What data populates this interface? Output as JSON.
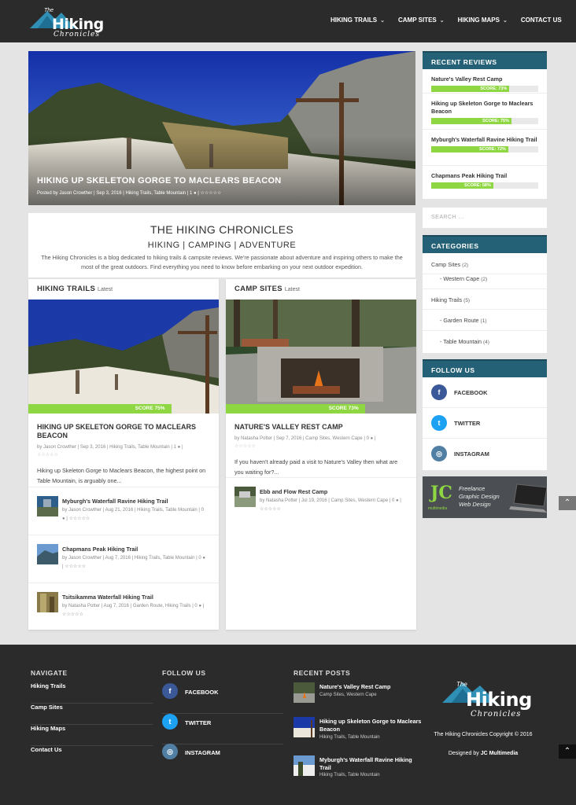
{
  "site": {
    "logo_the": "The",
    "logo_main": "Hiking",
    "logo_sub": "Chronicles"
  },
  "nav": [
    {
      "label": "HIKING TRAILS",
      "dropdown": true
    },
    {
      "label": "CAMP SITES",
      "dropdown": true
    },
    {
      "label": "HIKING MAPS",
      "dropdown": true
    },
    {
      "label": "CONTACT US",
      "dropdown": false
    }
  ],
  "hero": {
    "title": "HIKING UP SKELETON GORGE TO MACLEARS BEACON",
    "meta": "Posted by Jason Crowther | Sep 3, 2016 | Hiking Trails, Table Mountain | 1 ● | ☆☆☆☆☆"
  },
  "intro": {
    "title": "THE HIKING CHRONICLES",
    "subtitle": "HIKING | CAMPING | ADVENTURE",
    "text": "The Hiking Chronicles is a blog dedicated to hiking trails & campsite reviews. We're passionate about adventure and inspiring others to make the most of the great outdoors. Find everything you need to know before embarking on your next outdoor expedition."
  },
  "hiking_trails": {
    "heading": "HIKING TRAILS",
    "latest": "Latest",
    "score": "SCORE 75%",
    "title": "HIKING UP SKELETON GORGE TO MACLEARS BEACON",
    "meta": "by Jason Crowther | Sep 3, 2016 | Hiking Trails, Table Mountain | 1 ● |",
    "stars": "☆☆☆☆☆",
    "excerpt": "Hiking up Skeleton Gorge to Maclears Beacon, the highest point on Table Mountain, is arguably one...",
    "items": [
      {
        "title": "Myburgh's Waterfall Ravine Hiking Trail",
        "meta": "by Jason Crowther | Aug 21, 2016 | Hiking Trails, Table Mountain | 0 ● | ☆☆☆☆☆"
      },
      {
        "title": "Chapmans Peak Hiking Trail",
        "meta": "by Jason Crowther | Aug 7, 2016 | Hiking Trails, Table Mountain | 0 ● | ☆☆☆☆☆"
      },
      {
        "title": "Tsitsikamma Waterfall Hiking Trail",
        "meta": "by Natasha Potter | Aug 7, 2016 | Garden Route, Hiking Trails | 0 ● | ☆☆☆☆☆"
      }
    ]
  },
  "camp_sites": {
    "heading": "CAMP SITES",
    "latest": "Latest",
    "score": "SCORE 73%",
    "title": "NATURE'S VALLEY REST CAMP",
    "meta": "by Natasha Potter | Sep 7, 2016 | Camp Sites, Western Cape | 0 ● |",
    "stars": "☆☆☆☆☆",
    "excerpt": "If you haven't already paid a visit to Nature's Valley then what are you waiting for?...",
    "items": [
      {
        "title": "Ebb and Flow Rest Camp",
        "meta": "by Natasha Potter | Jul 19, 2016 | Camp Sites, Western Cape | 0 ● | ☆☆☆☆☆"
      }
    ]
  },
  "recent_reviews": {
    "heading": "RECENT REVIEWS",
    "items": [
      {
        "title": "Nature's Valley Rest Camp",
        "score": "SCORE: 73%",
        "value": 0.73
      },
      {
        "title": "Hiking up Skeleton Gorge to Maclears Beacon",
        "score": "SCORE: 75%",
        "value": 0.75
      },
      {
        "title": "Myburgh's Waterfall Ravine Hiking Trail",
        "score": "SCORE: 72%",
        "value": 0.72
      },
      {
        "title": "Chapmans Peak Hiking Trail",
        "score": "SCORE: 58%",
        "value": 0.58
      }
    ]
  },
  "search": {
    "placeholder": "SEARCH ..."
  },
  "categories": {
    "heading": "CATEGORIES",
    "items": [
      {
        "label": "Camp Sites",
        "count": "(2)"
      },
      {
        "label": "- Western Cape",
        "count": "(2)"
      },
      {
        "label": "Hiking Trails",
        "count": "(5)"
      },
      {
        "label": "- Garden Route",
        "count": "(1)"
      },
      {
        "label": "- Table Mountain",
        "count": "(4)"
      }
    ]
  },
  "follow": {
    "heading": "FOLLOW US",
    "items": [
      {
        "label": "FACEBOOK",
        "icon": "facebook-icon",
        "color": "#3b5998"
      },
      {
        "label": "TWITTER",
        "icon": "twitter-icon",
        "color": "#1da1f2"
      },
      {
        "label": "INSTAGRAM",
        "icon": "instagram-icon",
        "color": "#517fa4"
      }
    ]
  },
  "ad": {
    "logo": "JC",
    "logo_sub": "multimedia",
    "lines": [
      "Freelance",
      "Graphic Design",
      "Web Design"
    ]
  },
  "footer": {
    "navigate_heading": "NAVIGATE",
    "navigate": [
      "Hiking Trails",
      "Camp Sites",
      "Hiking Maps",
      "Contact Us"
    ],
    "follow_heading": "FOLLOW US",
    "follow": [
      "FACEBOOK",
      "TWITTER",
      "INSTAGRAM"
    ],
    "recent_heading": "RECENT POSTS",
    "recent": [
      {
        "title": "Nature's Valley Rest Camp",
        "meta": "Camp Sites, Western Cape"
      },
      {
        "title": "Hiking up Skeleton Gorge to Maclears Beacon",
        "meta": "Hiking Trails, Table Mountain"
      },
      {
        "title": "Myburgh's Waterfall Ravine Hiking Trail",
        "meta": "Hiking Trails, Table Mountain"
      }
    ],
    "copyright": "The Hiking Chronicles Copyright © 2016",
    "designed_prefix": "Designed by ",
    "designed_by": "JC Multimedia"
  },
  "colors": {
    "accent": "#246176",
    "score": "#8ed642",
    "header": "#2b2b2b"
  }
}
